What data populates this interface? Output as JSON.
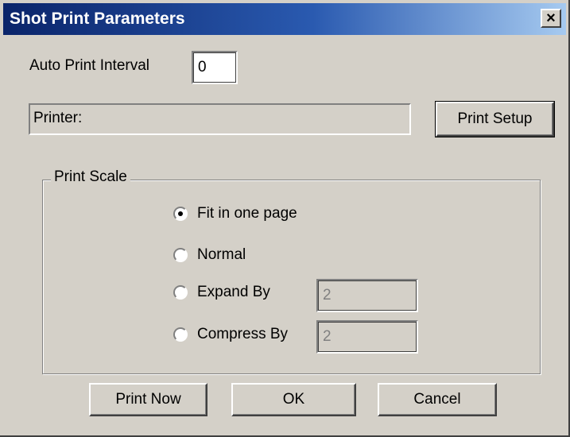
{
  "window": {
    "title": "Shot Print Parameters",
    "close_label": "×"
  },
  "auto_print": {
    "label": "Auto Print Interval",
    "value": "0"
  },
  "printer": {
    "label": "Printer:"
  },
  "buttons": {
    "print_setup": "Print Setup",
    "print_now": "Print Now",
    "ok": "OK",
    "cancel": "Cancel"
  },
  "print_scale": {
    "legend": "Print Scale",
    "selected": "fit",
    "options": [
      {
        "id": "fit",
        "label": "Fit in one page"
      },
      {
        "id": "normal",
        "label": "Normal"
      },
      {
        "id": "expand",
        "label": "Expand By",
        "value": "2"
      },
      {
        "id": "compress",
        "label": "Compress By",
        "value": "2"
      }
    ]
  }
}
